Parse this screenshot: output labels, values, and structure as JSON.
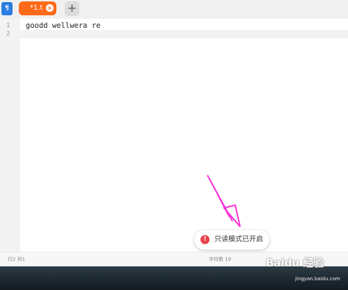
{
  "tabs": {
    "active_label": "*1.t",
    "close_glyph": "×",
    "add_glyph": "+"
  },
  "app_icon_glyph": "¶",
  "editor": {
    "line_numbers": [
      "1",
      "2"
    ],
    "lines": [
      "goodd wellwera re",
      ""
    ]
  },
  "status": {
    "position": "行2 列1",
    "char_count": "字符数 19"
  },
  "toast": {
    "icon_glyph": "!",
    "message": "只读模式已开启"
  },
  "watermark": {
    "brand": "Baidu 经验",
    "url": "jingyan.baidu.com"
  },
  "colors": {
    "accent": "#ff6a1a",
    "arrow": "#ff2fd6",
    "error": "#e8414a",
    "app_icon": "#2a7de1"
  }
}
